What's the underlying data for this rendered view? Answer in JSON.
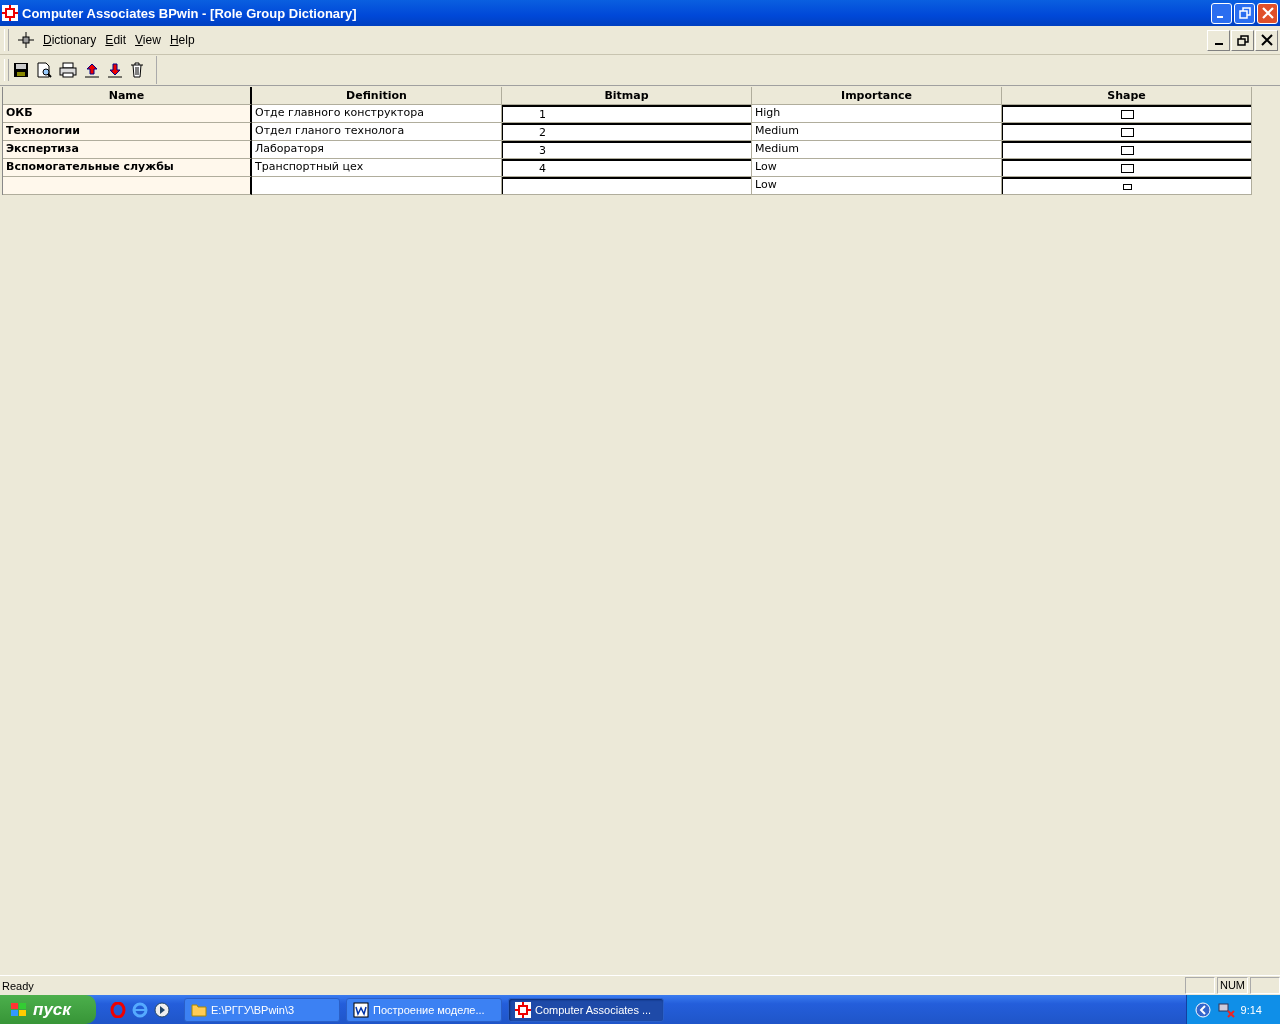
{
  "window": {
    "title": "Computer Associates BPwin - [Role Group Dictionary]"
  },
  "menu": [
    "Dictionary",
    "Edit",
    "View",
    "Help"
  ],
  "table": {
    "columns": [
      "Name",
      "Definition",
      "Bitmap",
      "Importance",
      "Shape"
    ],
    "rows": [
      {
        "name": "ОКБ",
        "definition": "Отде главного конструктора",
        "bitmap": "1",
        "importance": "High"
      },
      {
        "name": "Технологии",
        "definition": "Отдел гланого технолога",
        "bitmap": "2",
        "importance": "Medium"
      },
      {
        "name": "Экспертиза",
        "definition": "Лабораторя",
        "bitmap": "3",
        "importance": "Medium"
      },
      {
        "name": "Вспомогательные службы",
        "definition": "Транспортный цех",
        "bitmap": "4",
        "importance": "Low"
      },
      {
        "importance": "Low"
      }
    ]
  },
  "status_bar": {
    "text": "Ready",
    "indicator": "NUM"
  },
  "taskbar": {
    "start": "пуск",
    "tasks": [
      {
        "label": "E:\\РГГУ\\BPwin\\3",
        "kind": "folder",
        "selected": false
      },
      {
        "label": "Построение моделе...",
        "kind": "word",
        "selected": false
      },
      {
        "label": "Computer Associates ...",
        "kind": "bpwin",
        "selected": true
      }
    ],
    "clock": "9:14"
  }
}
